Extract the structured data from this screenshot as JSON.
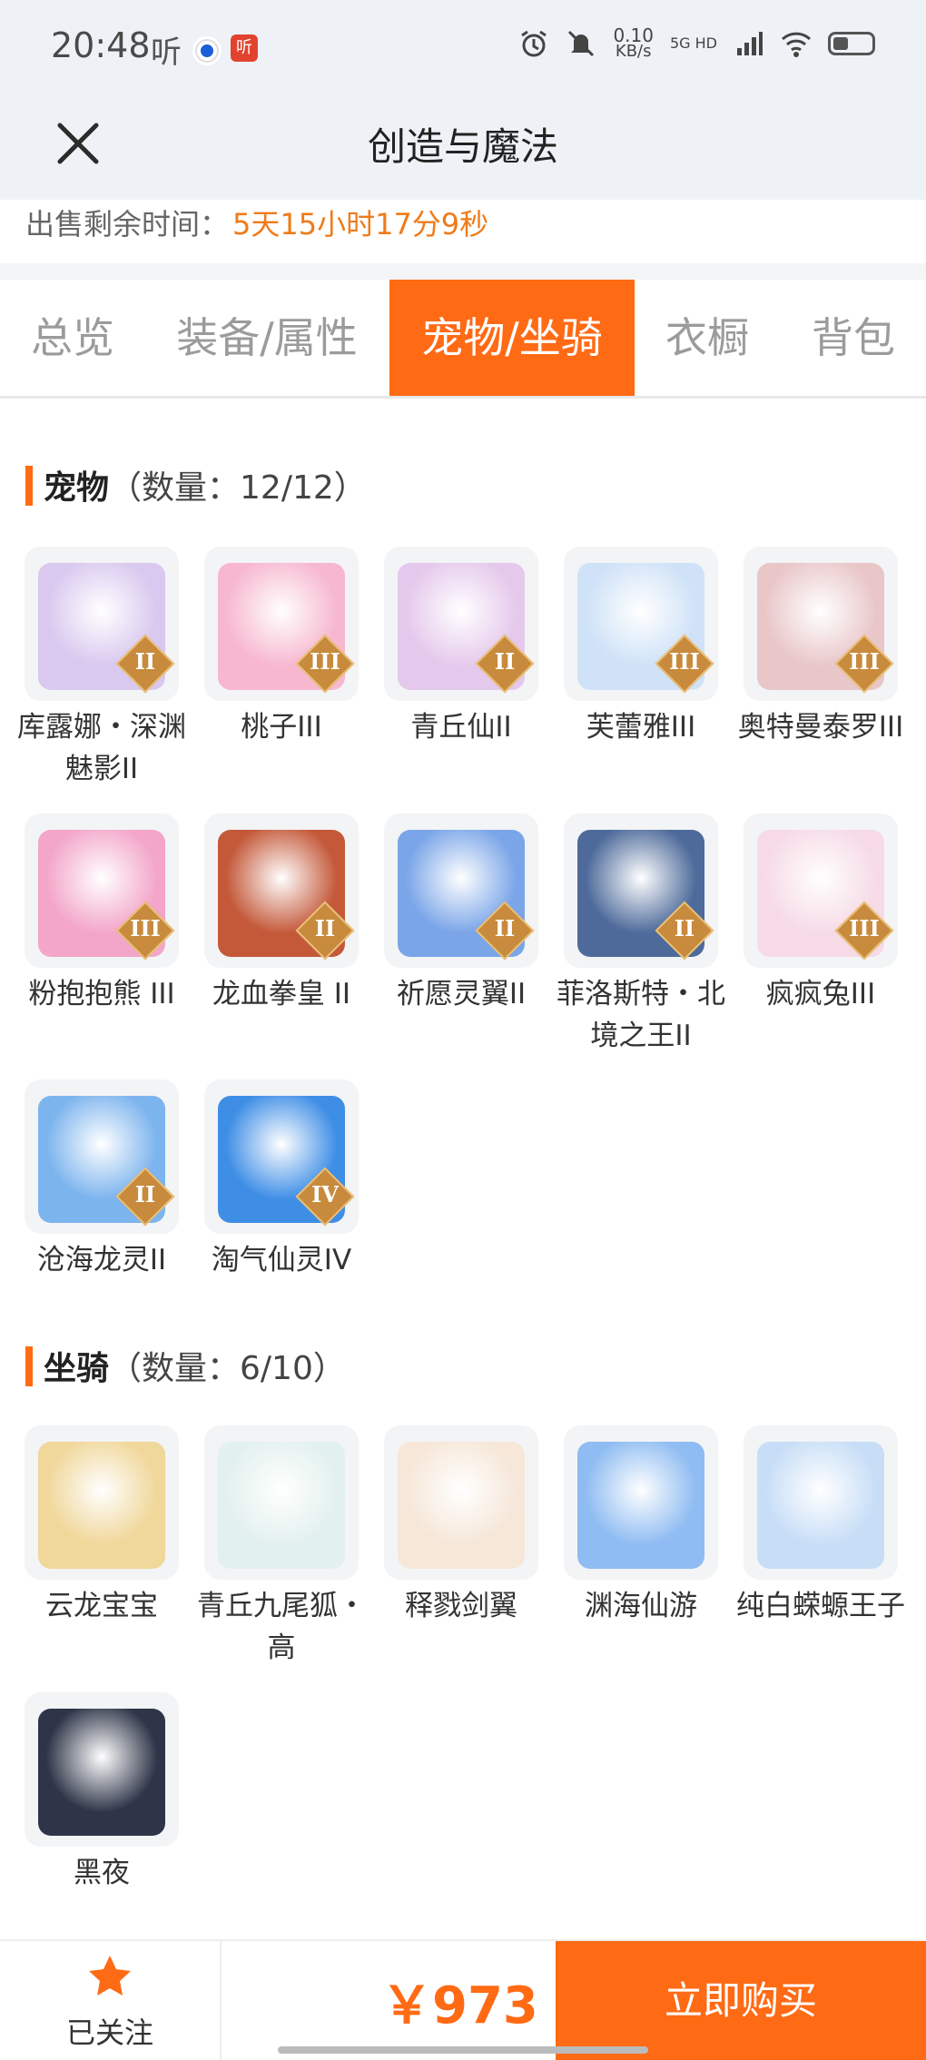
{
  "status_bar": {
    "time": "20:48",
    "note_icon_label": "听",
    "app_icon_label": "听",
    "net_speed": "0.10",
    "net_unit": "KB/s",
    "network": "5G HD"
  },
  "header": {
    "title": "创造与魔法"
  },
  "sell": {
    "label": "出售剩余时间：",
    "value": "5天15小时17分9秒"
  },
  "tabs": [
    {
      "label": "总览"
    },
    {
      "label": "装备/属性"
    },
    {
      "label": "宠物/坐骑"
    },
    {
      "label": "衣橱"
    },
    {
      "label": "背包"
    }
  ],
  "pets_section": {
    "title": "宠物",
    "count": "（数量：12/12）"
  },
  "pets": [
    {
      "name": "库露娜・深渊魅影II",
      "badge": "II",
      "color": "#d9c8ef"
    },
    {
      "name": "桃子III",
      "badge": "III",
      "color": "#f7b8cf"
    },
    {
      "name": "青丘仙II",
      "badge": "II",
      "color": "#e5c9ec"
    },
    {
      "name": "芙蕾雅III",
      "badge": "III",
      "color": "#cfe2f7"
    },
    {
      "name": "奥特曼泰罗III",
      "badge": "III",
      "color": "#e9c7c9"
    },
    {
      "name": "粉抱抱熊 III",
      "badge": "III",
      "color": "#f3a6c9"
    },
    {
      "name": "龙血拳皇 II",
      "badge": "II",
      "color": "#c4593a"
    },
    {
      "name": "祈愿灵翼II",
      "badge": "II",
      "color": "#7aa5e8"
    },
    {
      "name": "菲洛斯特・北境之王II",
      "badge": "II",
      "color": "#4d6a9a"
    },
    {
      "name": "疯疯兔III",
      "badge": "III",
      "color": "#f6dbe6"
    },
    {
      "name": "沧海龙灵II",
      "badge": "II",
      "color": "#7cb4ee"
    },
    {
      "name": "淘气仙灵IV",
      "badge": "IV",
      "color": "#3f8ee6"
    }
  ],
  "mounts_section": {
    "title": "坐骑",
    "count": "（数量：6/10）"
  },
  "mounts": [
    {
      "name": "云龙宝宝",
      "color": "#f0d79a"
    },
    {
      "name": "青丘九尾狐・高",
      "color": "#e3f1ee"
    },
    {
      "name": "释戮剑翼",
      "color": "#f6e7d8"
    },
    {
      "name": "渊海仙游",
      "color": "#8fbcf2"
    },
    {
      "name": "纯白蝾螈王子",
      "color": "#c8def7"
    },
    {
      "name": "黑夜",
      "color": "#2e3548"
    }
  ],
  "bottom": {
    "follow_label": "已关注",
    "price": "￥973",
    "buy_label": "立即购买"
  },
  "colors": {
    "accent": "#ff6a14",
    "sell_time": "#f07b1a"
  }
}
